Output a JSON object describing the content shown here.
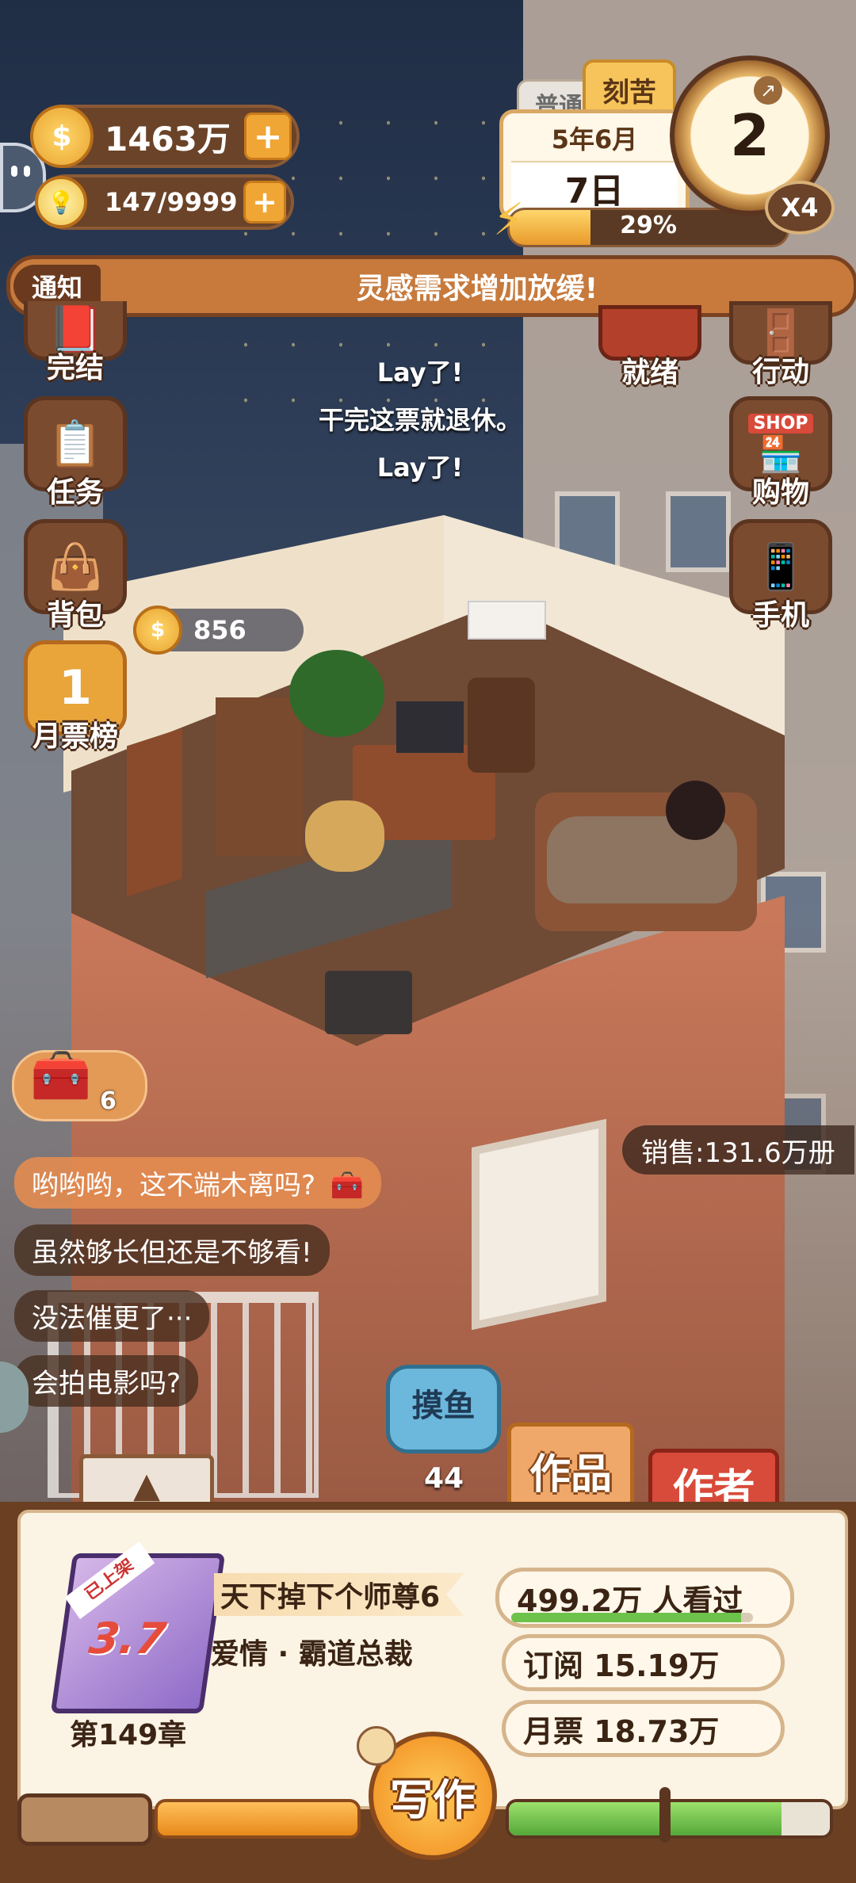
{
  "resources": {
    "gold": "1463万",
    "inspiration": "147/9999"
  },
  "calendar": {
    "mode_tab_normal": "普通",
    "mode_tab_hard": "刻苦",
    "year_month": "5年6月",
    "day": "7日",
    "energy_percent_text": "29%",
    "energy_fraction": 0.29,
    "clock_value": "2",
    "speed": "X4"
  },
  "notice": {
    "label": "通知",
    "text": "灵感需求增加放缓!"
  },
  "left_menu": [
    {
      "label": "完结",
      "icon": "book-icon"
    },
    {
      "label": "任务",
      "icon": "clipboard-icon"
    },
    {
      "label": "背包",
      "icon": "bag-icon"
    },
    {
      "label": "月票榜",
      "icon": "trophy-icon",
      "badge": "1"
    }
  ],
  "right_menu": [
    {
      "label": "就绪",
      "icon": "ready-icon"
    },
    {
      "label": "行动",
      "icon": "door-icon"
    },
    {
      "label": "购物",
      "icon": "shop-icon",
      "sign": "SHOP"
    },
    {
      "label": "手机",
      "icon": "phone-icon"
    }
  ],
  "thought_lines": [
    "Lay了!",
    "干完这票就退休。",
    "Lay了!"
  ],
  "coin_bubble": "856",
  "treasure_count": "6",
  "sales": "销售:131.6万册",
  "comments": [
    "哟哟哟，这不端木离吗?",
    "虽然够长但还是不够看!",
    "没法催更了···",
    "会拍电影吗?"
  ],
  "slack": {
    "label": "摸鱼",
    "count": "44"
  },
  "tabs": {
    "works": "作品",
    "author": "作者"
  },
  "book": {
    "status_ribbon": "已上架",
    "rating": "3.7",
    "title": "天下掉下个师尊6",
    "genre": "爱情 · 霸道总裁",
    "chapter": "第149章",
    "views": "499.2万 人看过",
    "views_bar_fraction": 0.95,
    "subscriptions": "订阅 15.19万",
    "monthly_tickets": "月票 18.73万"
  },
  "write_button": "写作",
  "colors": {
    "accent_orange": "#f0a635",
    "hud_brown": "#6b4328",
    "notice_bar": "#c77a3c",
    "green_bar": "#6cc24a"
  }
}
